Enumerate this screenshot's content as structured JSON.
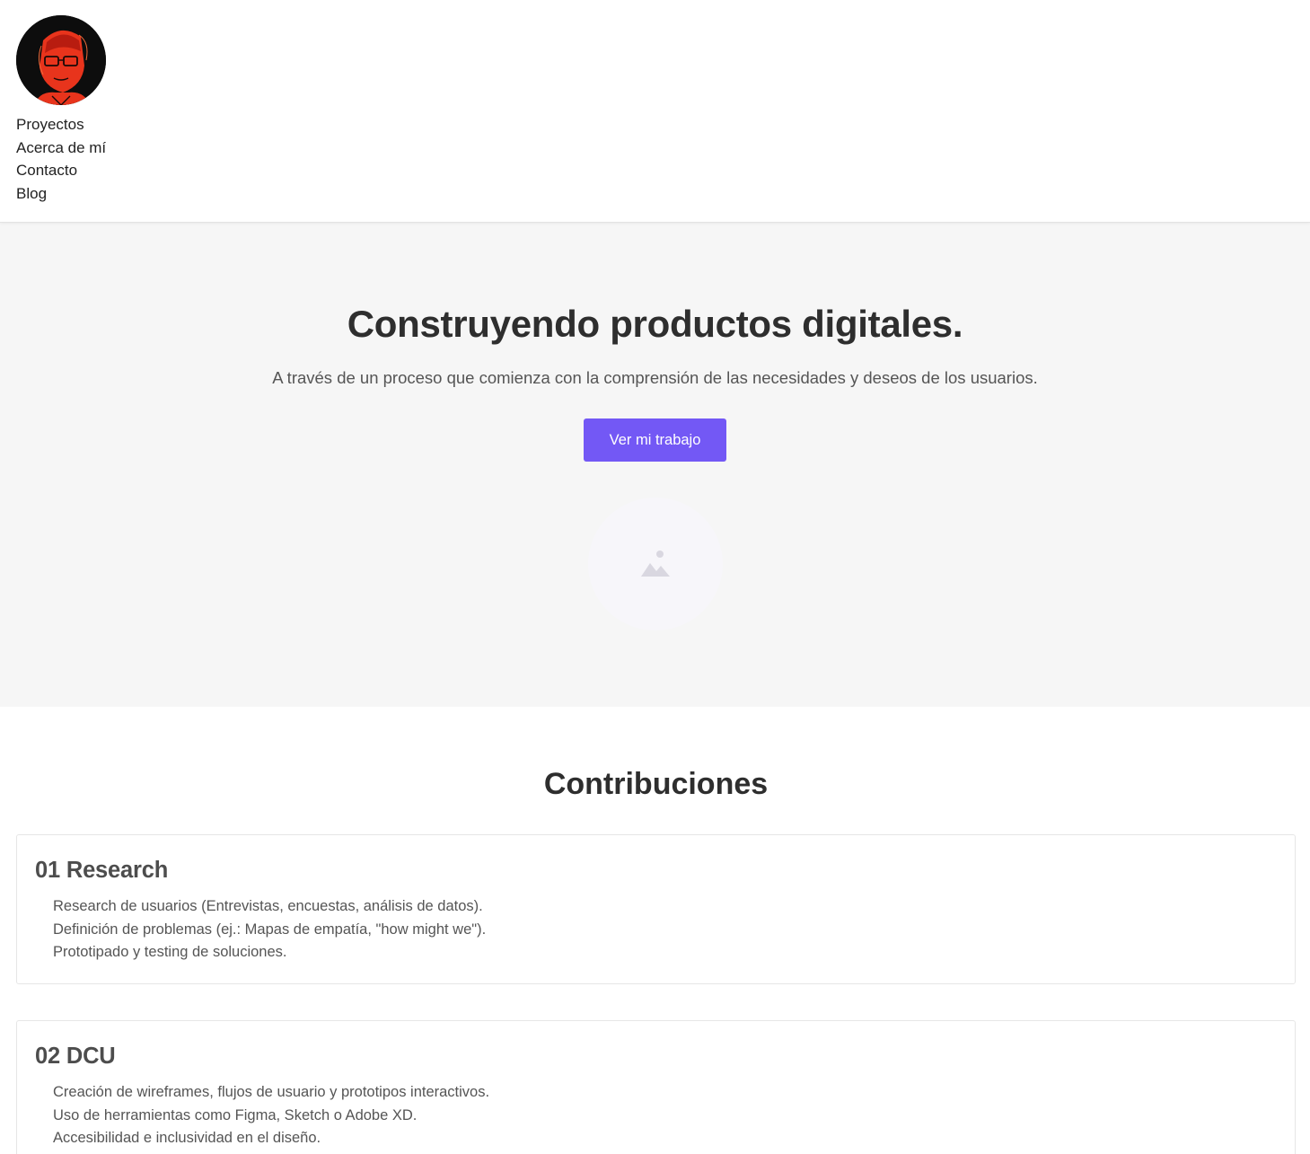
{
  "header": {
    "avatar_alt": "Foto de perfil",
    "nav": [
      {
        "label": "Proyectos"
      },
      {
        "label": "Acerca de mí"
      },
      {
        "label": "Contacto"
      },
      {
        "label": "Blog"
      }
    ]
  },
  "hero": {
    "title": "Construyendo productos digitales.",
    "subtitle": "A través de un proceso que comienza con la comprensión de las necesidades y deseos de los usuarios.",
    "cta_label": "Ver mi trabajo",
    "image_icon": "image-placeholder-icon"
  },
  "contributions": {
    "title": "Contribuciones",
    "cards": [
      {
        "title": "01 Research",
        "items": [
          "Research de usuarios (Entrevistas, encuestas, análisis de datos).",
          "Definición de problemas (ej.: Mapas de empatía, \"how might we\").",
          "Prototipado y testing de soluciones."
        ]
      },
      {
        "title": "02 DCU",
        "items": [
          "Creación de wireframes, flujos de usuario y prototipos interactivos.",
          "Uso de herramientas como Figma, Sketch o Adobe XD.",
          "Accesibilidad e inclusividad en el diseño."
        ]
      }
    ]
  },
  "colors": {
    "accent": "#7358f5",
    "hero_bg": "#f6f6f6",
    "text": "#333333"
  }
}
